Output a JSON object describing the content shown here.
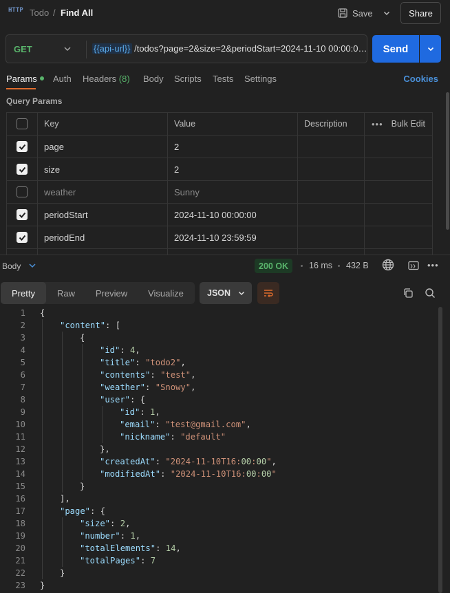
{
  "header": {
    "http_icon": "HTTP",
    "breadcrumb_parent": "Todo",
    "breadcrumb_sep": "/",
    "breadcrumb_current": "Find All",
    "save_label": "Save",
    "share_label": "Share"
  },
  "request": {
    "method": "GET",
    "url_variable": "{{api-url}}",
    "url_path": "/todos?page=2&size=2&periodStart=2024-11-10 00:00:0…",
    "send_label": "Send"
  },
  "tabs": {
    "params": "Params",
    "auth": "Auth",
    "headers": "Headers",
    "headers_count": "(8)",
    "body": "Body",
    "scripts": "Scripts",
    "tests": "Tests",
    "settings": "Settings",
    "cookies": "Cookies"
  },
  "query_params": {
    "title": "Query Params",
    "columns": {
      "key": "Key",
      "value": "Value",
      "description": "Description",
      "bulk_edit": "Bulk Edit"
    },
    "rows": [
      {
        "checked": true,
        "key": "page",
        "value": "2"
      },
      {
        "checked": true,
        "key": "size",
        "value": "2"
      },
      {
        "checked": false,
        "key": "weather",
        "value": "Sunny"
      },
      {
        "checked": true,
        "key": "periodStart",
        "value": "2024-11-10 00:00:00"
      },
      {
        "checked": true,
        "key": "periodEnd",
        "value": "2024-11-10 23:59:59"
      }
    ]
  },
  "response": {
    "body_label": "Body",
    "status": "200 OK",
    "time": "16 ms",
    "size": "432 B",
    "view_tabs": [
      "Pretty",
      "Raw",
      "Preview",
      "Visualize"
    ],
    "active_view": "Pretty",
    "format": "JSON"
  },
  "code_lines": [
    "{",
    "\"content\": [",
    "{",
    "\"id\": 4,",
    "\"title\": \"todo2\",",
    "\"contents\": \"test\",",
    "\"weather\": \"Snowy\",",
    "\"user\": {",
    "\"id\": 1,",
    "\"email\": \"test@gmail.com\",",
    "\"nickname\": \"default\"",
    "},",
    "\"createdAt\": \"2024-11-10T16:00:00\",",
    "\"modifiedAt\": \"2024-11-10T16:00:00\"",
    "}",
    "],",
    "\"page\": {",
    "\"size\": 2,",
    "\"number\": 1,",
    "\"totalElements\": 14,",
    "\"totalPages\": 7",
    "}",
    "}"
  ],
  "colors": {
    "accent_orange": "#e06c2c",
    "send_blue": "#1f6ae0",
    "method_green": "#59b46b",
    "json_key": "#9cdcfe",
    "json_string": "#ce9178",
    "json_number": "#b5cea8"
  }
}
